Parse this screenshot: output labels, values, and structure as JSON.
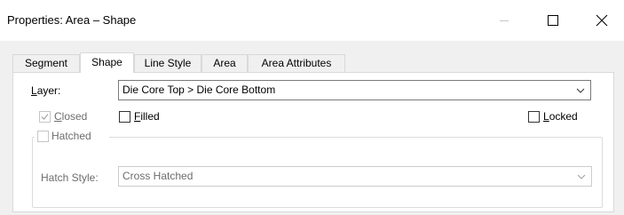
{
  "window": {
    "title": "Properties: Area – Shape"
  },
  "tabs": [
    {
      "label": "Segment"
    },
    {
      "label": "Shape",
      "active": true
    },
    {
      "label": "Line Style"
    },
    {
      "label": "Area"
    },
    {
      "label": "Area Attributes"
    }
  ],
  "layer": {
    "label_underlined": "L",
    "label_rest": "ayer:",
    "value": "Die Core Top > Die Core Bottom"
  },
  "closed": {
    "label_underlined": "C",
    "label_rest": "losed",
    "checked": true,
    "enabled": false
  },
  "filled": {
    "label_underlined": "F",
    "label_rest": "illed",
    "checked": false
  },
  "locked": {
    "label_underlined": "L",
    "label_rest": "ocked",
    "checked": false
  },
  "hatched": {
    "label": "Hatched",
    "checked": false,
    "enabled": false
  },
  "hatch_style": {
    "label": "Hatch Style:",
    "value": "Cross Hatched",
    "enabled": false
  },
  "icons": {
    "minimize": "minimize-icon",
    "maximize": "maximize-icon",
    "close": "close-icon",
    "dropdown": "chevron-down-icon",
    "check": "check-icon"
  }
}
